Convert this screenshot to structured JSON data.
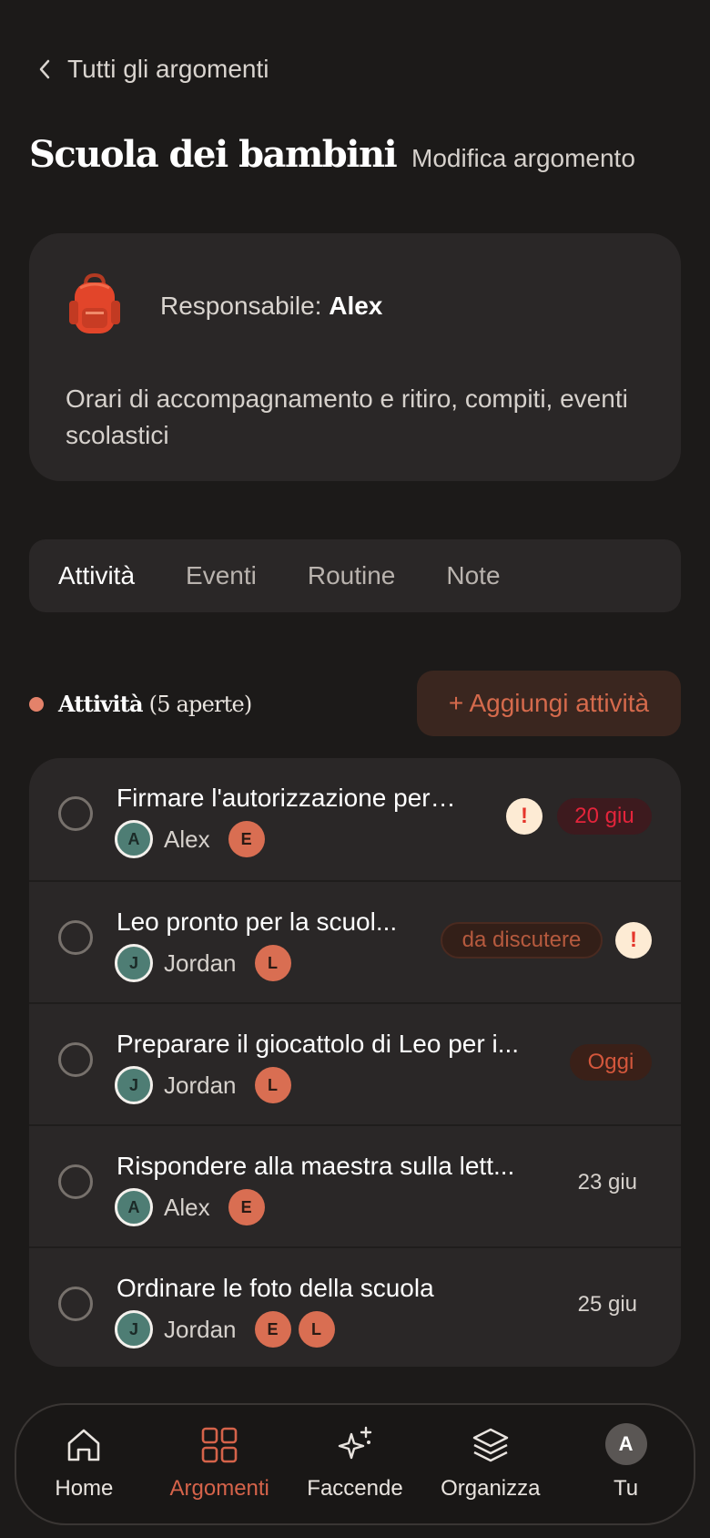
{
  "nav_back": {
    "label": "Tutti gli argomenti"
  },
  "header": {
    "title": "Scuola dei bambini",
    "edit_label": "Modifica argomento"
  },
  "topic": {
    "icon": "backpack-icon",
    "owner_prefix": "Responsabile:",
    "owner_name": "Alex",
    "description": "Orari di accompagnamento e ritiro, compiti, eventi scolastici"
  },
  "tabs": [
    "Attività",
    "Eventi",
    "Routine",
    "Note"
  ],
  "active_tab": "Attività",
  "section": {
    "title": "Attività",
    "count_label": "(5 aperte)",
    "add_label": "+ Aggiungi attività"
  },
  "tasks": [
    {
      "title": "Firmare l'autorizzazione per l...",
      "assignee": "Alex",
      "assignee_initial": "A",
      "kids": [
        "E"
      ],
      "urgent": "!",
      "due": "20 giu",
      "due_style": "overdue"
    },
    {
      "title": "Leo pronto per la scuol...",
      "assignee": "Jordan",
      "assignee_initial": "J",
      "kids": [
        "L"
      ],
      "status": "da discutere",
      "urgent": "!"
    },
    {
      "title": "Preparare il giocattolo di Leo per i...",
      "assignee": "Jordan",
      "assignee_initial": "J",
      "kids": [
        "L"
      ],
      "due": "Oggi",
      "due_style": "today"
    },
    {
      "title": "Rispondere alla maestra sulla lett...",
      "assignee": "Alex",
      "assignee_initial": "A",
      "kids": [
        "E"
      ],
      "due": "23 giu",
      "due_style": "plain"
    },
    {
      "title": "Ordinare le foto della scuola",
      "assignee": "Jordan",
      "assignee_initial": "J",
      "kids": [
        "E",
        "L"
      ],
      "due": "25 giu",
      "due_style": "plain"
    }
  ],
  "tabbar": {
    "items": [
      {
        "label": "Home",
        "icon": "home-icon"
      },
      {
        "label": "Argomenti",
        "icon": "grid-icon",
        "active": true
      },
      {
        "label": "Faccende",
        "icon": "sparkle-icon"
      },
      {
        "label": "Organizza",
        "icon": "layers-icon"
      },
      {
        "label": "Tu",
        "icon": "avatar",
        "initial": "A"
      }
    ]
  },
  "colors": {
    "accent": "#d5634a",
    "background": "#1c1a19",
    "card": "#2a2727",
    "overdue": "#e4243b"
  }
}
